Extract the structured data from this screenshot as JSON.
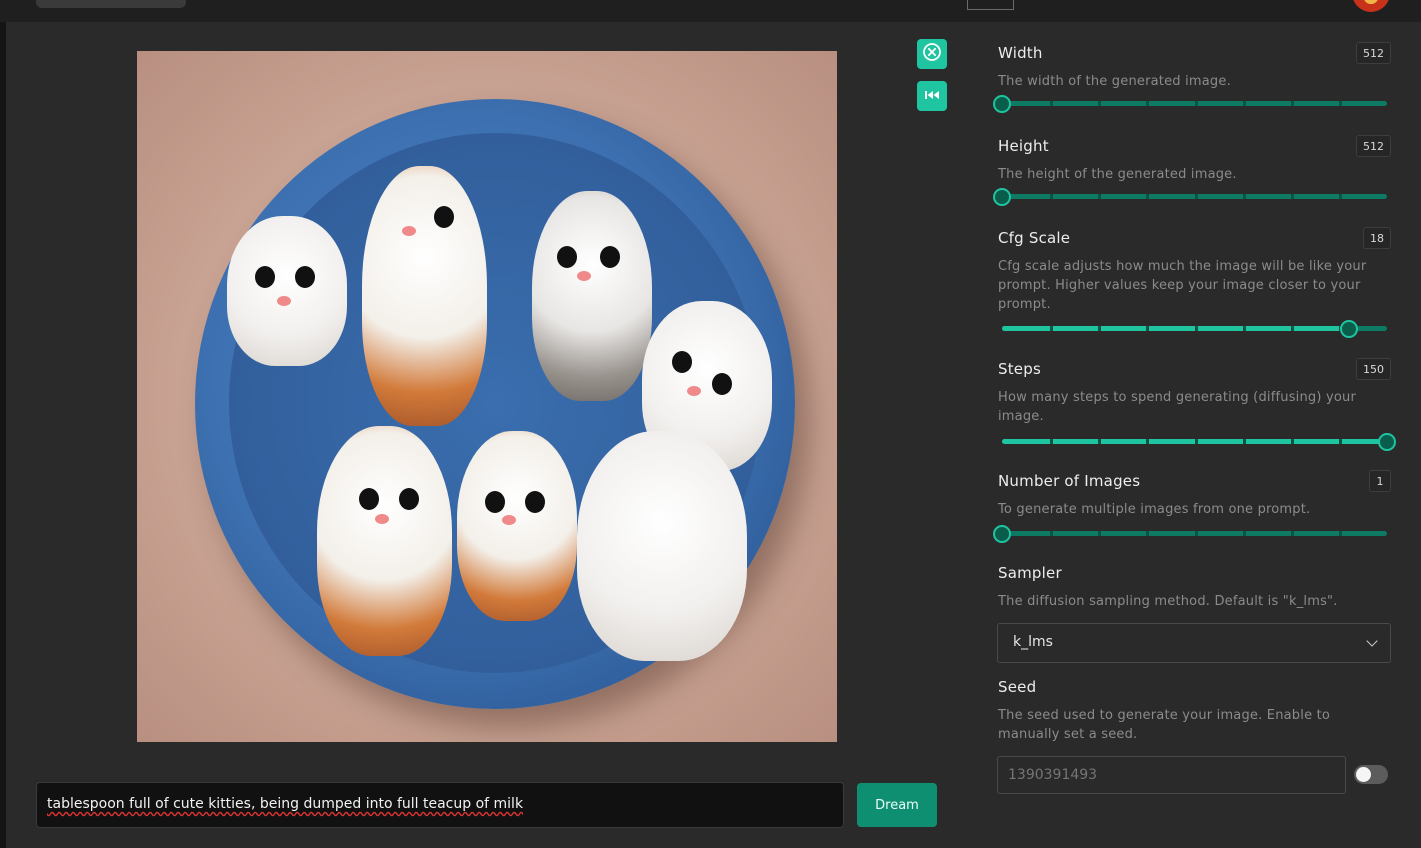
{
  "main": {
    "prompt_value": "tablespoon full  of cute kitties, being dumped into full teacup of milk",
    "dream_label": "Dream",
    "icons": {
      "cancel": "circle-x-icon",
      "rewind": "rewind-icon"
    }
  },
  "settings": {
    "width": {
      "label": "Width",
      "desc": "The width of the generated image.",
      "value": "512"
    },
    "height": {
      "label": "Height",
      "desc": "The height of the generated image.",
      "value": "512"
    },
    "cfg": {
      "label": "Cfg Scale",
      "desc": "Cfg scale adjusts how much the image will be like your prompt. Higher values keep your image closer to your prompt.",
      "value": "18"
    },
    "steps": {
      "label": "Steps",
      "desc": "How many steps to spend generating (diffusing) your image.",
      "value": "150"
    },
    "num_images": {
      "label": "Number of Images",
      "desc": "To generate multiple images from one prompt.",
      "value": "1"
    },
    "sampler": {
      "label": "Sampler",
      "desc": "The diffusion sampling method. Default is \"k_lms\".",
      "value": "k_lms"
    },
    "seed": {
      "label": "Seed",
      "desc": "The seed used to generate your image. Enable to manually set a seed.",
      "placeholder": "1390391493"
    }
  },
  "slider_levels": {
    "width": 0.0,
    "height": 0.0,
    "cfg": 0.9,
    "steps": 1.0,
    "num_images": 0.0
  },
  "seed_toggle_on": false,
  "colors": {
    "accent": "#1fc4a0",
    "accent_dark": "#0f8f72",
    "background": "#2a2a2a"
  }
}
